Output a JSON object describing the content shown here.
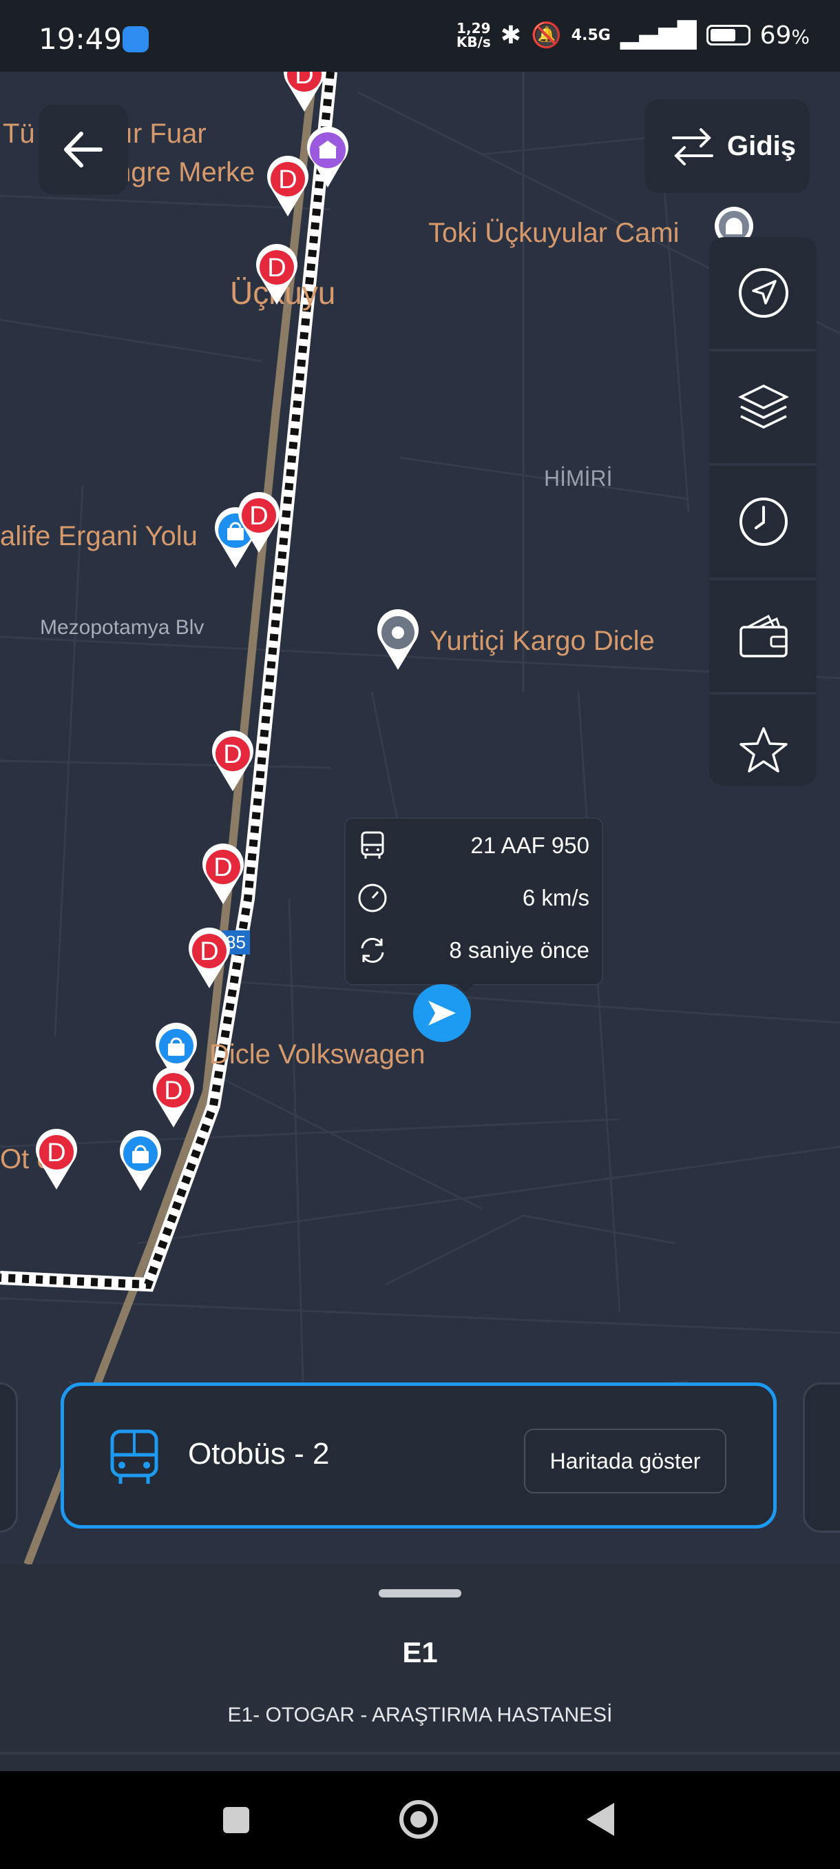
{
  "status_bar": {
    "time": "19:49",
    "net_speed_value": "1,29",
    "net_speed_unit": "KB/s",
    "network": "4.5G",
    "battery": "69",
    "battery_unit": "%"
  },
  "header": {
    "direction_label": "Gidiş"
  },
  "map": {
    "places": {
      "fuar_line1": "Tü  yarbakır Fuar",
      "fuar_line2": "ngre Merke",
      "toki": "Toki Üçkuyular Cami",
      "uckuyu": "Üçkuyu",
      "himiri": "HİMİRİ",
      "halife": "alife Ergani Yolu",
      "mezopotamya": "Mezopotamya Blv",
      "yurtici": "Yurtiçi Kargo Dicle",
      "road_number": "85",
      "dicle_vw": "Dicle Volkswagen",
      "otogar_partial": "Ot     eç"
    },
    "stop_letter": "D"
  },
  "vehicle_popup": {
    "plate": "21 AAF 950",
    "speed": "6 km/s",
    "updated": "8 saniye önce"
  },
  "bus_card": {
    "name": "Otobüs - 2",
    "show_on_map": "Haritada göster"
  },
  "sheet": {
    "route_code": "E1",
    "route_name": "E1- OTOGAR - ARAŞTIRMA HASTANESİ"
  },
  "colors": {
    "accent": "#1d9af1",
    "stop_red": "#e5283c",
    "shop_blue": "#1d8ff0",
    "poi_purple": "#9b59e0",
    "place_label": "#d79a6c"
  }
}
